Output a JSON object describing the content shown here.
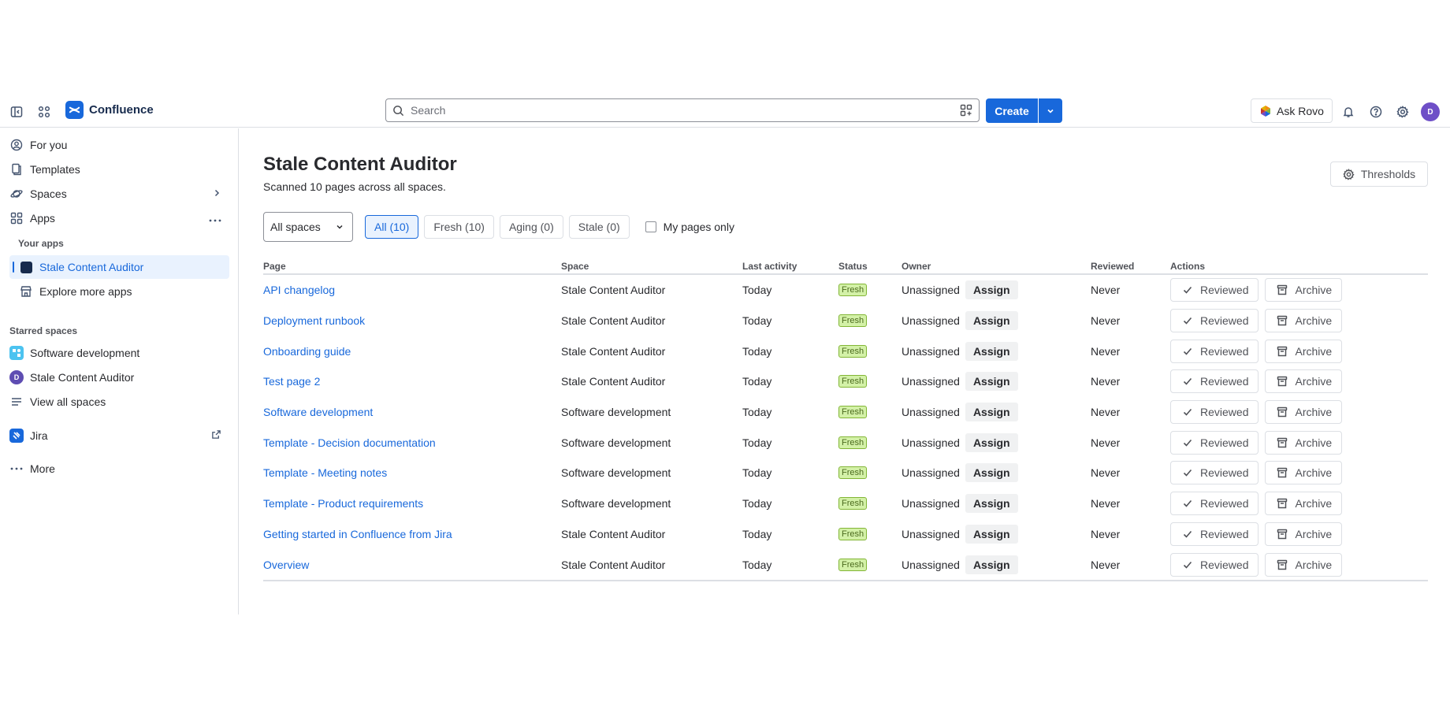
{
  "topnav": {
    "app_name": "Confluence",
    "search_placeholder": "Search",
    "create_label": "Create",
    "ask_rovo_label": "Ask Rovo",
    "avatar_initial": "D"
  },
  "sidebar": {
    "items": [
      {
        "label": "For you",
        "icon": "user-circle-icon"
      },
      {
        "label": "Templates",
        "icon": "template-icon"
      },
      {
        "label": "Spaces",
        "icon": "spaces-icon"
      },
      {
        "label": "Apps",
        "icon": "apps-icon"
      }
    ],
    "your_apps_heading": "Your apps",
    "apps": [
      {
        "label": "Stale Content Auditor",
        "active": true
      },
      {
        "label": "Explore more apps",
        "active": false
      }
    ],
    "starred_heading": "Starred spaces",
    "starred": [
      {
        "label": "Software development",
        "icon": "software-space-icon"
      },
      {
        "label": "Stale Content Auditor",
        "icon": "d-space-icon"
      },
      {
        "label": "View all spaces",
        "icon": "list-icon"
      }
    ],
    "jira_label": "Jira",
    "more_label": "More",
    "space_d_letter": "D"
  },
  "main": {
    "title": "Stale Content Auditor",
    "subtitle": "Scanned 10 pages across all spaces.",
    "thresholds_label": "Thresholds",
    "space_filter": "All spaces",
    "chips": [
      "All (10)",
      "Fresh (10)",
      "Aging (0)",
      "Stale (0)"
    ],
    "my_pages_label": "My pages only"
  },
  "table": {
    "headers": {
      "page": "Page",
      "space": "Space",
      "last_activity": "Last activity",
      "status": "Status",
      "owner": "Owner",
      "reviewed": "Reviewed",
      "actions": "Actions"
    },
    "assign_label": "Assign",
    "reviewed_btn": "Reviewed",
    "archive_btn": "Archive",
    "rows": [
      {
        "page": "API changelog",
        "space": "Stale Content Auditor",
        "activity": "Today",
        "status": "Fresh",
        "owner": "Unassigned",
        "reviewed": "Never"
      },
      {
        "page": "Deployment runbook",
        "space": "Stale Content Auditor",
        "activity": "Today",
        "status": "Fresh",
        "owner": "Unassigned",
        "reviewed": "Never"
      },
      {
        "page": "Onboarding guide",
        "space": "Stale Content Auditor",
        "activity": "Today",
        "status": "Fresh",
        "owner": "Unassigned",
        "reviewed": "Never"
      },
      {
        "page": "Test page 2",
        "space": "Stale Content Auditor",
        "activity": "Today",
        "status": "Fresh",
        "owner": "Unassigned",
        "reviewed": "Never"
      },
      {
        "page": "Software development",
        "space": "Software development",
        "activity": "Today",
        "status": "Fresh",
        "owner": "Unassigned",
        "reviewed": "Never"
      },
      {
        "page": "Template - Decision documentation",
        "space": "Software development",
        "activity": "Today",
        "status": "Fresh",
        "owner": "Unassigned",
        "reviewed": "Never"
      },
      {
        "page": "Template - Meeting notes",
        "space": "Software development",
        "activity": "Today",
        "status": "Fresh",
        "owner": "Unassigned",
        "reviewed": "Never"
      },
      {
        "page": "Template - Product requirements",
        "space": "Software development",
        "activity": "Today",
        "status": "Fresh",
        "owner": "Unassigned",
        "reviewed": "Never"
      },
      {
        "page": "Getting started in Confluence from Jira",
        "space": "Stale Content Auditor",
        "activity": "Today",
        "status": "Fresh",
        "owner": "Unassigned",
        "reviewed": "Never"
      },
      {
        "page": "Overview",
        "space": "Stale Content Auditor",
        "activity": "Today",
        "status": "Fresh",
        "owner": "Unassigned",
        "reviewed": "Never"
      }
    ]
  },
  "colors": {
    "brand": "#1868db",
    "fresh_bg": "#d3f1a7"
  }
}
